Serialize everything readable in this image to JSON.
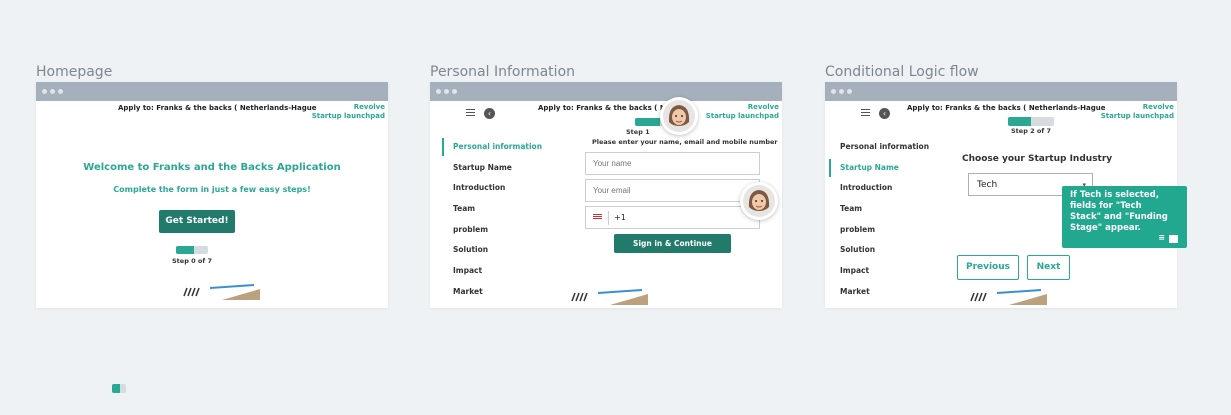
{
  "frames": [
    {
      "title": "Homepage",
      "apply_text": "Apply to: Franks & the backs ( Netherlands-Hague",
      "brand_line1": "Revolve",
      "brand_line2": "Startup launchpad",
      "welcome": "Welcome to Franks and the Backs Application",
      "subtitle": "Complete the form in just a few easy steps!",
      "cta": "Get Started!",
      "step": "Step 0 of 7",
      "progress": 0.55
    },
    {
      "title": "Personal Information",
      "apply_text": "Apply to: Franks & the backs ( Netherl",
      "brand_line1": "Revolve",
      "brand_line2": "Startup launchpad",
      "step": "Step 1",
      "progress": 0.55,
      "instruction": "Please enter your name, email and mobile number",
      "name_placeholder": "Your name",
      "email_placeholder": "Your email",
      "phone_prefix": "+1",
      "submit": "Sign in & Continue"
    },
    {
      "title": "Conditional Logic flow",
      "apply_text": "Apply to: Franks & the backs ( Netherlands-Hague",
      "brand_line1": "Revolve",
      "brand_line2": "Startup launchpad",
      "step": "Step 2 of 7",
      "progress": 0.55,
      "question": "Choose your Startup Industry",
      "selected_industry": "Tech",
      "prev": "Previous",
      "next": "Next",
      "tooltip": "If Tech is selected, fields for \"Tech Stack\" and \"Funding Stage\" appear."
    }
  ],
  "sidebar": [
    "Personal information",
    "Startup Name",
    "Introduction",
    "Team",
    "problem",
    "Solution",
    "Impact",
    "Market"
  ],
  "colors": {
    "accent": "#2aa893",
    "dark_button": "#217a6a",
    "chrome": "#a5b0bc",
    "background": "#eef2f5"
  },
  "icons": [
    "menu-icon",
    "back-arrow-icon",
    "avatar-icon",
    "us-flag-icon",
    "note-icon",
    "bookmark-icon",
    "dropdown-chevron-icon"
  ]
}
